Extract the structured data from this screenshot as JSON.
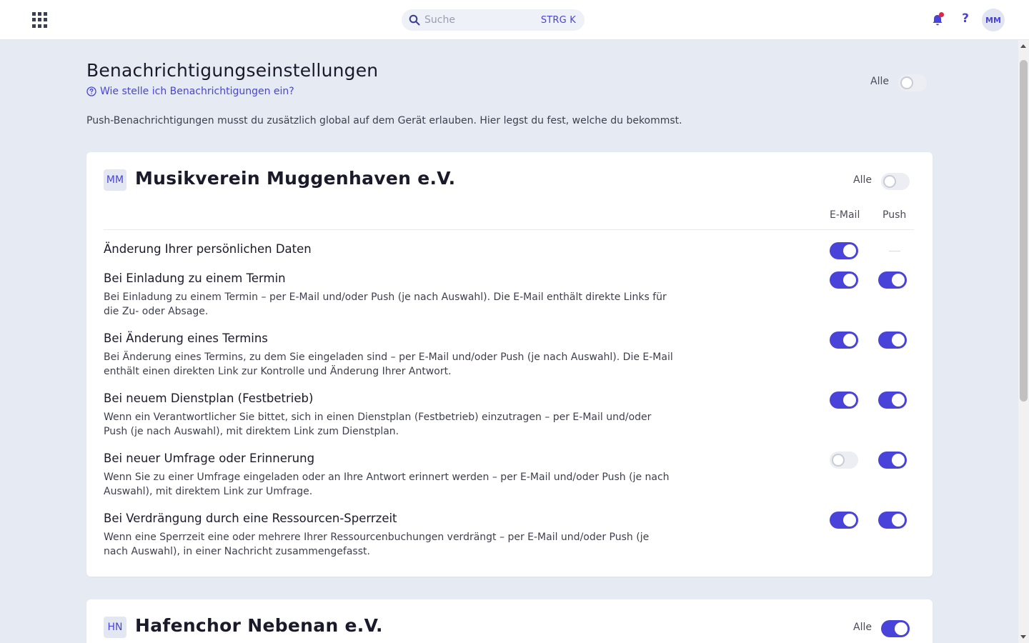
{
  "topbar": {
    "search_placeholder": "Suche",
    "search_shortcut": "STRG K",
    "avatar_initials": "MM"
  },
  "header": {
    "title": "Benachrichtigungseinstellungen",
    "help_link": "Wie stelle ich Benachrichtigungen ein?",
    "intro": "Push-Benachrichtigungen musst du zusätzlich global auf dem Gerät erlauben. Hier legst du fest, welche du bekommst.",
    "all_label": "Alle",
    "all_enabled": false
  },
  "colors": {
    "accent": "#4a43d9",
    "background": "#e6ebf3",
    "notification_dot": "#e0263c"
  },
  "organizations": [
    {
      "initials": "MM",
      "name": "Musikverein Muggenhaven e.V.",
      "all_label": "Alle",
      "all_enabled": false,
      "col_email": "E-Mail",
      "col_push": "Push",
      "rows": [
        {
          "title": "Änderung Ihrer persönlichen Daten",
          "desc": "",
          "email": true,
          "push": null
        },
        {
          "title": "Bei Einladung zu einem Termin",
          "desc": "Bei Einladung zu einem Termin – per E-Mail und/oder Push (je nach Auswahl). Die E-Mail enthält direkte Links für die Zu- oder Absage.",
          "email": true,
          "push": true
        },
        {
          "title": "Bei Änderung eines Termins",
          "desc": "Bei Änderung eines Termins, zu dem Sie eingeladen sind – per E-Mail und/oder Push (je nach Auswahl). Die E-Mail enthält einen direkten Link zur Kontrolle und Änderung Ihrer Antwort.",
          "email": true,
          "push": true
        },
        {
          "title": "Bei neuem Dienstplan (Festbetrieb)",
          "desc": "Wenn ein Verantwortlicher Sie bittet, sich in einen Dienstplan (Festbetrieb) einzutragen – per E-Mail und/oder Push (je nach Auswahl), mit direktem Link zum Dienstplan.",
          "email": true,
          "push": true
        },
        {
          "title": "Bei neuer Umfrage oder Erinnerung",
          "desc": "Wenn Sie zu einer Umfrage eingeladen oder an Ihre Antwort erinnert werden – per E-Mail und/oder Push (je nach Auswahl), mit direktem Link zur Umfrage.",
          "email": false,
          "push": true
        },
        {
          "title": "Bei Verdrängung durch eine Ressourcen-Sperrzeit",
          "desc": "Wenn eine Sperrzeit eine oder mehrere Ihrer Ressourcenbuchungen verdrängt – per E-Mail und/oder Push (je nach Auswahl), in einer Nachricht zusammengefasst.",
          "email": true,
          "push": true
        }
      ]
    },
    {
      "initials": "HN",
      "name": "Hafenchor Nebenan e.V.",
      "all_label": "Alle",
      "all_enabled": true
    }
  ]
}
